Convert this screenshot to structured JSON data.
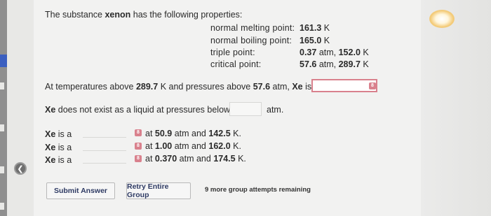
{
  "intro": {
    "pre": "The substance ",
    "substance": "xenon",
    "post": " has the following properties:"
  },
  "properties": [
    {
      "label": "normal melting point:",
      "value_bold": "161.3",
      "unit": " K"
    },
    {
      "label": "normal boiling point:",
      "value_bold": "165.0",
      "unit": " K"
    },
    {
      "label": "triple point:",
      "value_bold": "0.37",
      "unit": " atm, ",
      "value_bold2": "152.0",
      "unit2": " K"
    },
    {
      "label": "critical point:",
      "value_bold": "57.6",
      "unit": " atm, ",
      "value_bold2": "289.7",
      "unit2": " K"
    }
  ],
  "q1": {
    "pre": "At temperatures above ",
    "t": "289.7",
    "mid": " K and pressures above ",
    "p": "57.6",
    "post": " atm, ",
    "xe": "Xe",
    "end": " is a"
  },
  "q2": {
    "xe": "Xe",
    "text": " does not exist as a liquid at pressures below",
    "unit": "atm."
  },
  "q3": [
    {
      "xe": "Xe",
      "text": " is a",
      "cond_pre": "at ",
      "p": "50.9",
      "cond_mid": " atm and ",
      "t": "142.5",
      "cond_post": " K."
    },
    {
      "xe": "Xe",
      "text": " is a",
      "cond_pre": "at ",
      "p": "1.00",
      "cond_mid": " atm and ",
      "t": "162.0",
      "cond_post": " K."
    },
    {
      "xe": "Xe",
      "text": " is a",
      "cond_pre": "at ",
      "p": "0.370",
      "cond_mid": " atm and ",
      "t": "174.5",
      "cond_post": " K."
    }
  ],
  "badge_glyph": "8",
  "buttons": {
    "submit": "Submit Answer",
    "retry": "Retry Entire Group"
  },
  "attempts_text": "9 more group attempts remaining",
  "icons": {
    "back": "chevron-left-icon",
    "select_badge": "dropdown-badge-icon"
  },
  "colors": {
    "error_border": "#d9818d",
    "button_text": "#2e3a63"
  }
}
